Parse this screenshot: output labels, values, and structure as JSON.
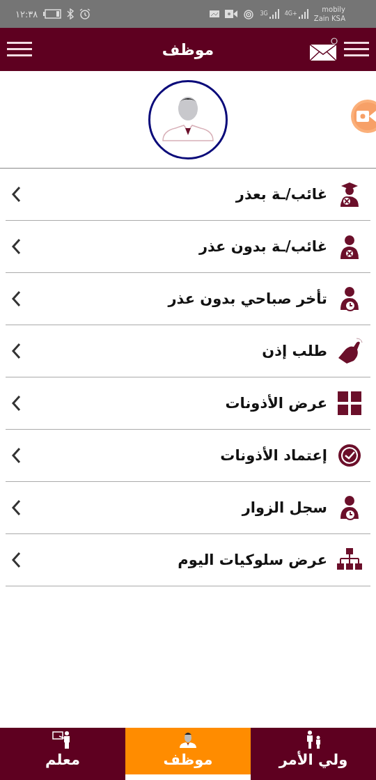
{
  "status_bar": {
    "time": "١٢:٣٨",
    "carrier_1": "mobily",
    "carrier_2": "Zain KSA",
    "network_1": "3G",
    "network_2": "4G+"
  },
  "header": {
    "title": "موظف",
    "has_message_dot": true
  },
  "menu": [
    {
      "label": "غائب/ـة بعذر",
      "kind": "graduate-x"
    },
    {
      "label": "غائب/ـة بدون عذر",
      "kind": "person-x"
    },
    {
      "label": "تأخر صباحي بدون عذر",
      "kind": "person-clock"
    },
    {
      "label": "طلب إذن",
      "kind": "hand"
    },
    {
      "label": "عرض الأذونات",
      "kind": "grid"
    },
    {
      "label": "إعتماد الأذونات",
      "kind": "check-circle"
    },
    {
      "label": "سجل الزوار",
      "kind": "person-clock"
    },
    {
      "label": "عرض سلوكيات اليوم",
      "kind": "org-chart"
    }
  ],
  "tabs": [
    {
      "label": "ولي الأمر",
      "kind": "parent-child",
      "selected": false
    },
    {
      "label": "موظف",
      "kind": "employee",
      "selected": true
    },
    {
      "label": "معلم",
      "kind": "teacher",
      "selected": false
    }
  ]
}
